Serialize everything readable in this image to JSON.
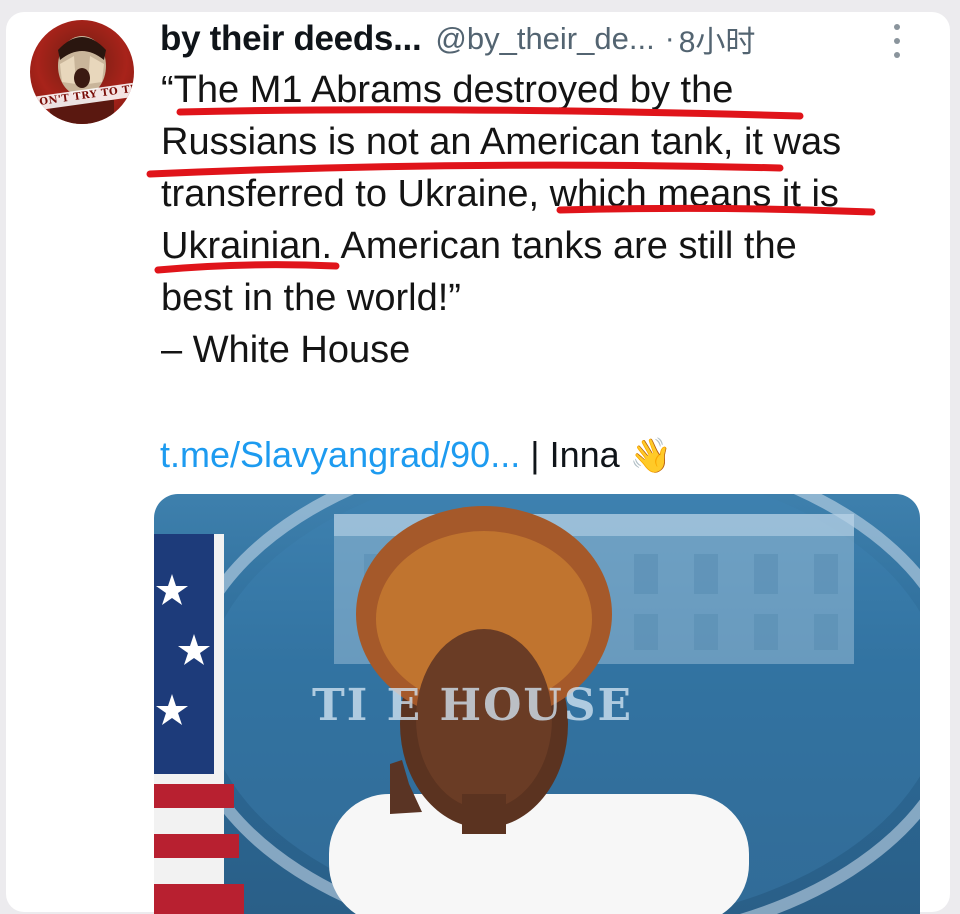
{
  "post": {
    "author_name": "by their deeds...",
    "author_handle": "@by_their_de...",
    "separator": "·",
    "time": "8小时",
    "avatar_text": "DON'T TRY TO THINK",
    "body_lines": [
      "“The M1 Abrams destroyed by the",
      "Russians is not an American tank, it was",
      "transferred to Ukraine, which means it is",
      "Ukrainian. American tanks are still the",
      "best in the world!”",
      "– White House"
    ],
    "link_text": "t.me/Slavyangrad/90...",
    "pipe": "|",
    "link_author": "Inna",
    "link_emoji": "👋"
  },
  "media": {
    "seal_text": "TI        E HOUSE"
  },
  "colors": {
    "link": "#1d9bf0",
    "underline": "#e0141a",
    "muted": "#536471"
  },
  "icons": {
    "more": "vertical-ellipsis-icon"
  }
}
